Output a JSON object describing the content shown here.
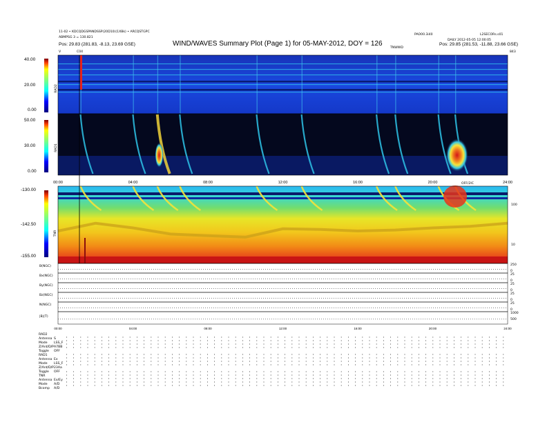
{
  "header": {
    "title": "WIND/WAVES Summary Plot (Page 1) for 05-MAY-2012, DOY = 126",
    "line1": "11-02 • KDCQDGSPANDSSP(20D10)(1XBk) • ARCQSTGPC",
    "line2": "ABMPSG 3 = 130.821",
    "position_left": "Pos:   29.83 (281.83, -8.13, 23.69 GSE)",
    "right_top": "PAO00.3i40",
    "right_top2": "L2SECORs.s01",
    "right_mid": "DAILY  2012-05-05 12:00:05",
    "right_mid2": "TNWWD",
    "position_right": "Pos:   29.85 (281.53, -11.88, 23.66 GSE)",
    "marker_left": "C04",
    "marker_v": "V",
    "marker_right": "843"
  },
  "colors": {
    "bg_blue": "#1a3fd6",
    "rad_dark": "#06103a",
    "tnr_yellow": "#f3e31f",
    "tnr_green": "#7ad83c",
    "tnr_red": "#e8221a"
  },
  "panels": {
    "rad2": {
      "label": "RAD2",
      "ticks": [
        "40.00",
        "20.00",
        "0.00"
      ]
    },
    "rad1": {
      "label": "RAD1",
      "ticks": [
        "50.00",
        "30.00",
        "0.00"
      ]
    },
    "tnr": {
      "label": "TNR",
      "ticks": [
        "-130.00",
        "-142.50",
        "-155.00"
      ],
      "right_ticks": [
        "100",
        "10"
      ]
    }
  },
  "time_axis": {
    "labels": [
      "00:00",
      "04:00",
      "08:00",
      "12:00",
      "16:00",
      "20:00",
      "24:00"
    ]
  },
  "mag_panels": [
    {
      "label": "B(NGC)",
      "right_ticks": [
        "250",
        "0"
      ]
    },
    {
      "label": "Bx(NGC)",
      "right_ticks": [
        "25",
        "0"
      ]
    },
    {
      "label": "By(NGC)",
      "right_ticks": [
        "25",
        "0"
      ]
    },
    {
      "label": "Bz(NGC)",
      "right_ticks": [
        "25",
        "0"
      ]
    },
    {
      "label": "N(NGC)",
      "right_ticks": [
        "25",
        "0"
      ]
    },
    {
      "label": "|B|(T)",
      "right_ticks": [
        "1000",
        "500"
      ]
    }
  ],
  "annotation_mid": "OFF/2IC",
  "receiver_settings": [
    {
      "group": "RAD2",
      "rows": [
        [
          "Antenna",
          "S"
        ],
        [
          "Mode",
          "LSS_F"
        ],
        [
          "Z/Ant/D/P",
          "A7BB"
        ],
        [
          "Toggle",
          "OFF"
        ]
      ]
    },
    {
      "group": "RAD1",
      "rows": [
        [
          "Antenna",
          "Ex"
        ],
        [
          "Mode",
          "LSS_F"
        ],
        [
          "Z/Ant/D/P",
          "23Aa"
        ],
        [
          "Toggle",
          "OFF"
        ]
      ]
    },
    {
      "group": "TNR",
      "rows": [
        [
          "Antenna",
          "Ex/Ey"
        ],
        [
          "Mode",
          "A/D"
        ],
        [
          "Bcomp",
          "A/D"
        ]
      ]
    }
  ],
  "chart_data": {
    "type": "heatmap",
    "title": "WIND/WAVES Summary Plot (Page 1) for 05-MAY-2012, DOY = 126",
    "x": [
      "00:00",
      "04:00",
      "08:00",
      "12:00",
      "16:00",
      "20:00",
      "24:00"
    ],
    "xlim": [
      0,
      24
    ],
    "series": [
      {
        "name": "RAD2",
        "ylim": [
          0,
          40
        ],
        "ticks": [
          0,
          20,
          40
        ]
      },
      {
        "name": "RAD1",
        "ylim": [
          0,
          50
        ],
        "ticks": [
          0,
          30,
          50
        ]
      },
      {
        "name": "TNR",
        "ylim": [
          -155,
          -130
        ],
        "ticks": [
          -155,
          -142.5,
          -130
        ]
      }
    ],
    "type_III_burst_hours": [
      1.2,
      4.0,
      5.3,
      6.5,
      10.6,
      13.0,
      17.0,
      18.0,
      20.3,
      21.2
    ],
    "tnr_line_hours": [
      0,
      2,
      4,
      6,
      8,
      10,
      12,
      14,
      16,
      18,
      20,
      22,
      24
    ],
    "tnr_plasma_line": [
      -144.5,
      -142.0,
      -143.5,
      -145.5,
      -146.0,
      -146.5,
      -143.8,
      -144.0,
      -144.5,
      -144.2,
      -143.5,
      -143.0,
      -142.0
    ]
  }
}
